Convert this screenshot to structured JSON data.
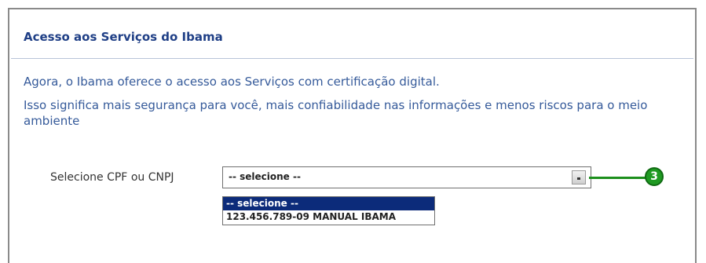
{
  "panel": {
    "title": "Acesso aos Serviços do Ibama",
    "paragraph1": "Agora, o Ibama oferece o acesso aos Serviços com certificação digital.",
    "paragraph2": "Isso significa mais segurança para você, mais confiabilidade nas informações e menos riscos para o meio ambiente"
  },
  "form": {
    "label": "Selecione CPF ou CNPJ",
    "selected_value": "-- selecione --",
    "options": [
      "-- selecione --",
      "123.456.789-09 MANUAL IBAMA"
    ]
  },
  "annotation": {
    "callout_number": "3",
    "callout_color": "#1f9a22"
  }
}
